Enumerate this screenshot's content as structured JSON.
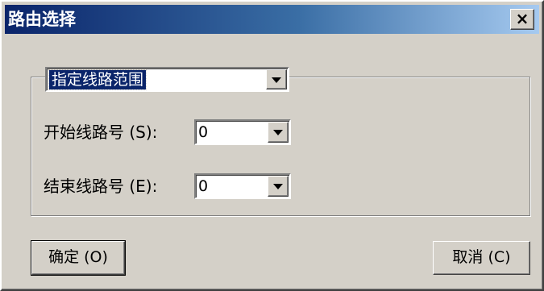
{
  "window": {
    "title": "路由选择",
    "close_label": "×"
  },
  "range_select": {
    "value": "指定线路范围"
  },
  "start_line": {
    "label": "开始线路号 (S):",
    "value": "0"
  },
  "end_line": {
    "label": "结束线路号 (E):",
    "value": "0"
  },
  "buttons": {
    "ok_label": "确定 (O)",
    "cancel_label": "取消 (C)"
  },
  "colors": {
    "title_gradient_start": "#0a246a",
    "title_gradient_end": "#a6caf0",
    "face": "#d4d0c8",
    "selection": "#0a246a"
  }
}
